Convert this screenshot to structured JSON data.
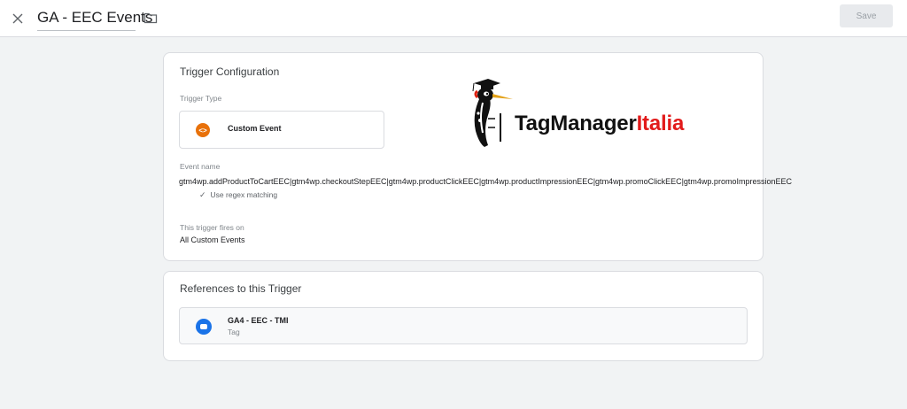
{
  "header": {
    "close_icon": "close-icon",
    "title": "GA - EEC Events",
    "folder_icon": "folder-icon",
    "save_label": "Save"
  },
  "trigger_config": {
    "section_title": "Trigger Configuration",
    "type_label": "Trigger Type",
    "type_name": "Custom Event",
    "type_icon": "custom-event-icon",
    "type_icon_color": "#e8710a",
    "event_name_label": "Event name",
    "event_name_value": "gtm4wp.addProductToCartEEC|gtm4wp.checkoutStepEEC|gtm4wp.productClickEEC|gtm4wp.productImpressionEEC|gtm4wp.promoClickEEC|gtm4wp.promoImpressionEEC",
    "regex_label": "Use regex matching",
    "fires_on_label": "This trigger fires on",
    "fires_on_value": "All Custom Events"
  },
  "watermark": {
    "brand_main": "TagManager",
    "brand_accent": "Italia",
    "accent_color": "#e21b1b"
  },
  "references": {
    "section_title": "References to this Trigger",
    "items": [
      {
        "name": "GA4 - EEC - TMI",
        "type": "Tag",
        "icon": "tag-icon",
        "icon_color": "#1a73e8"
      }
    ]
  }
}
